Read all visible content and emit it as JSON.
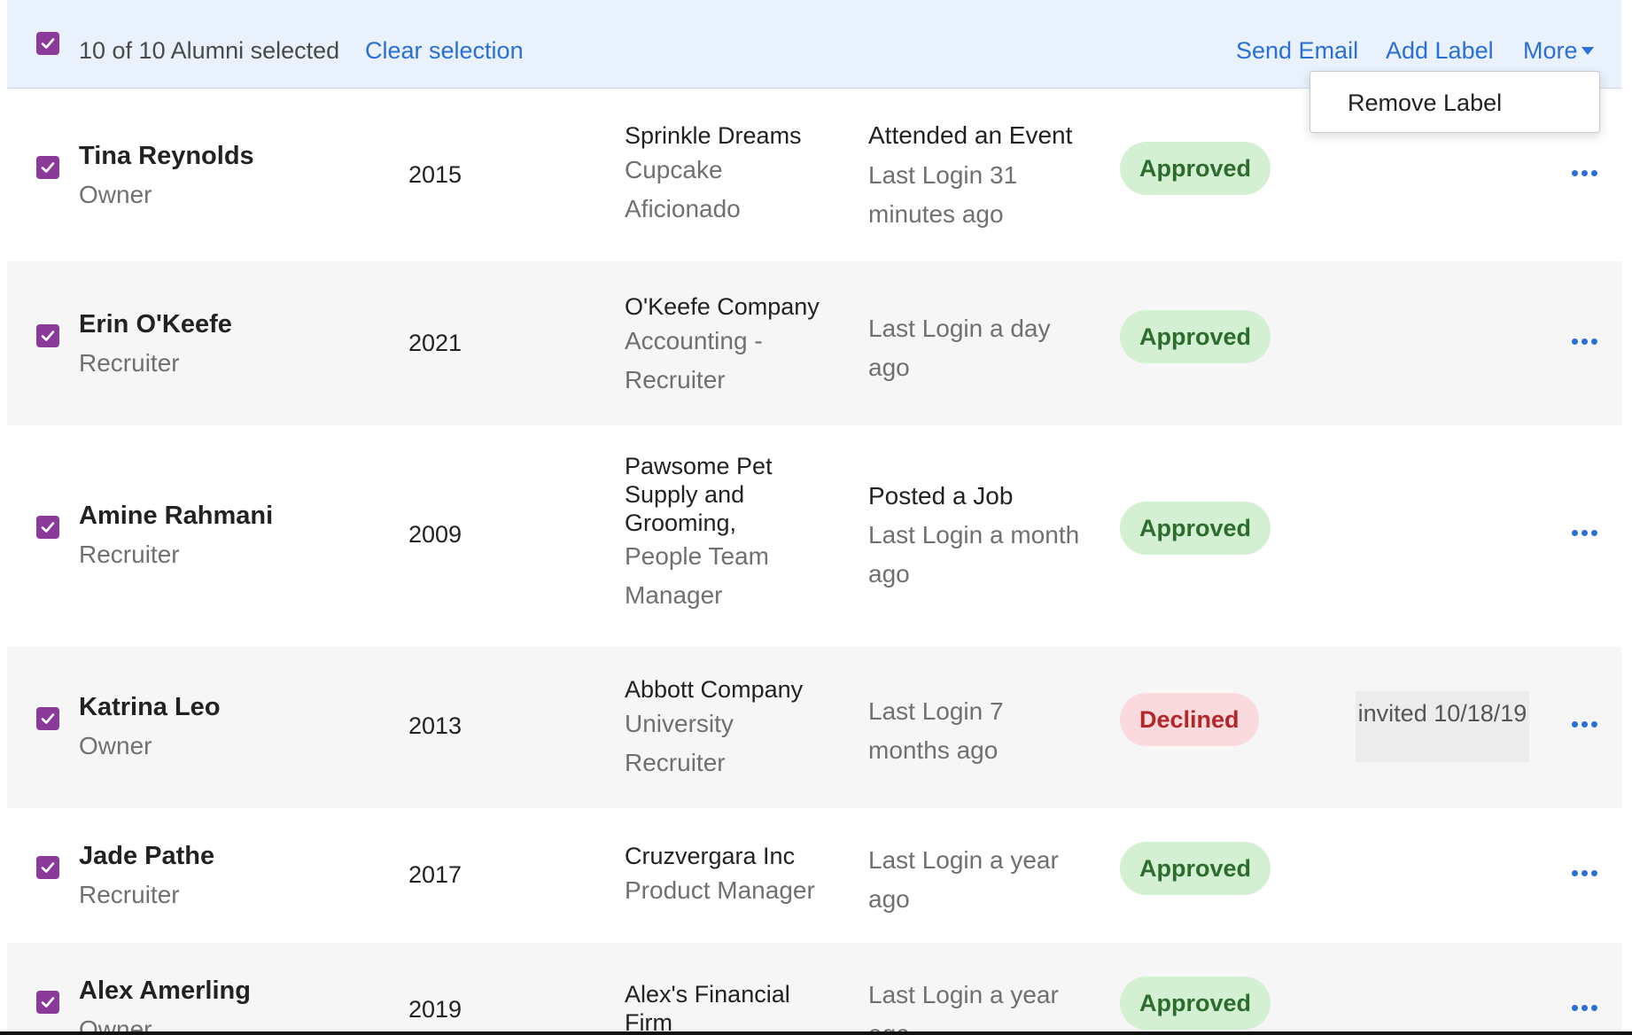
{
  "selection": {
    "count_text": "10 of 10 Alumni selected",
    "clear_label": "Clear selection",
    "send_email_label": "Send Email",
    "add_label_label": "Add Label",
    "more_label": "More"
  },
  "more_menu": {
    "items": [
      {
        "label": "Remove Label"
      }
    ]
  },
  "rows": [
    {
      "name": "Tina Reynolds",
      "role": "Owner",
      "year": "2015",
      "company": "Sprinkle Dreams",
      "title": "Cupcake Aficionado",
      "activity": "Attended an Event",
      "last_login": "Last Login 31 minutes ago",
      "status": "Approved"
    },
    {
      "name": "Erin O'Keefe",
      "role": "Recruiter",
      "year": "2021",
      "company": "O'Keefe Company",
      "title": "Accounting - Recruiter",
      "activity": "",
      "last_login": "Last Login a day ago",
      "status": "Approved"
    },
    {
      "name": "Amine Rahmani",
      "role": "Recruiter",
      "year": "2009",
      "company": "Pawsome Pet Supply and Grooming,",
      "title": "People Team Manager",
      "activity": "Posted a Job",
      "last_login": "Last Login a month ago",
      "status": "Approved"
    },
    {
      "name": "Katrina Leo",
      "role": "Owner",
      "year": "2013",
      "company": "Abbott Company",
      "title": "University Recruiter",
      "activity": "",
      "last_login": "Last Login 7 months ago",
      "status": "Declined",
      "invited": "invited 10/18/19"
    },
    {
      "name": "Jade Pathe",
      "role": "Recruiter",
      "year": "2017",
      "company": "Cruzvergara Inc",
      "title": "Product Manager",
      "activity": "",
      "last_login": "Last Login a year ago",
      "status": "Approved"
    },
    {
      "name": "Alex Amerling",
      "role": "Owner",
      "year": "2019",
      "company": "Alex's Financial Firm",
      "title": "",
      "activity": "",
      "last_login": "Last Login a year ago",
      "status": "Approved"
    }
  ],
  "colors": {
    "accent": "#2a6fd6",
    "checkbox": "#8b3a9c",
    "selection_bar": "#e8f1fc",
    "approved_bg": "#d4f0d2",
    "approved_text": "#2e6b2e",
    "declined_bg": "#fadadd",
    "declined_text": "#b3262a"
  },
  "icons": {
    "checkbox": "checkbox-checked-icon",
    "row_menu": "more-horizontal-icon",
    "dropdown": "caret-down-icon"
  }
}
